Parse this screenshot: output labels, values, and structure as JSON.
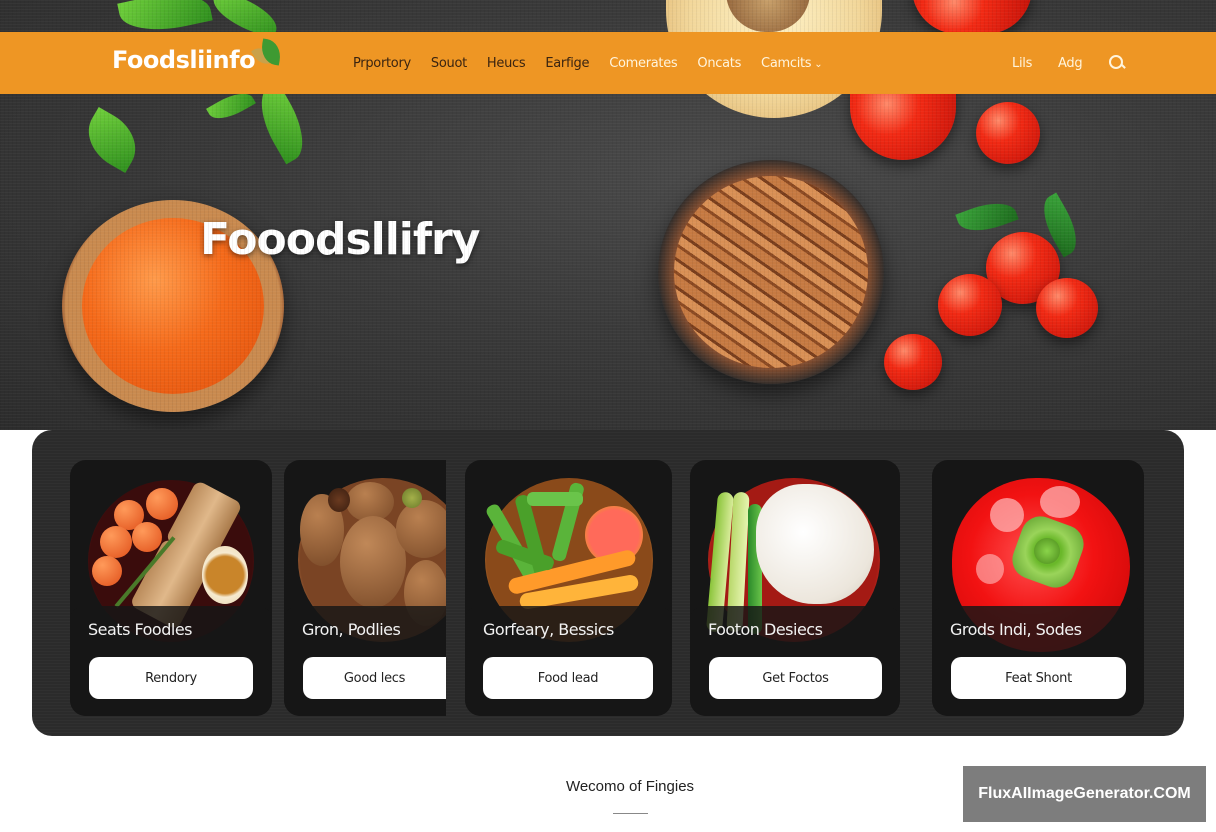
{
  "header": {
    "brand": "Foodsliinfo",
    "nav_links": [
      {
        "label": "Prportory",
        "tone": "dark"
      },
      {
        "label": "Souot",
        "tone": "dark"
      },
      {
        "label": "Heucs",
        "tone": "dark"
      },
      {
        "label": "Earfige",
        "tone": "dark"
      },
      {
        "label": "Comerates",
        "tone": "light"
      },
      {
        "label": "Oncats",
        "tone": "light"
      },
      {
        "label": "Camcits",
        "tone": "light",
        "dropdown": true
      }
    ],
    "right_links": [
      {
        "label": "Lils"
      },
      {
        "label": "Adg"
      }
    ],
    "search_icon": "search-icon"
  },
  "hero": {
    "title": "Fooodsllifry"
  },
  "cards": [
    {
      "title": "Seats Foodles",
      "button": "Rendory",
      "image": "tomatoes-and-rolls-bowl"
    },
    {
      "title": "Gron, Podlies",
      "button": "Good lecs",
      "image": "potatoes-bowl"
    },
    {
      "title": "Gorfeary, Bessics",
      "button": "Food lead",
      "image": "vegetables-and-citrus-bowl"
    },
    {
      "title": "Footon Desiecs",
      "button": "Get Foctos",
      "image": "leeks-and-cheese-bowl"
    },
    {
      "title": "Grods Indi, Sodes",
      "button": "Feat Shont",
      "image": "red-bell-pepper"
    }
  ],
  "welcome": {
    "text": "Wecomo of Fingies"
  },
  "watermark": "FluxAIImageGenerator.COM",
  "colors": {
    "nav_bg": "#ee9624",
    "hero_bg": "#3a3a3a",
    "panel_bg": "#2b2b2b",
    "card_bg": "#161616",
    "button_bg": "#ffffff"
  }
}
